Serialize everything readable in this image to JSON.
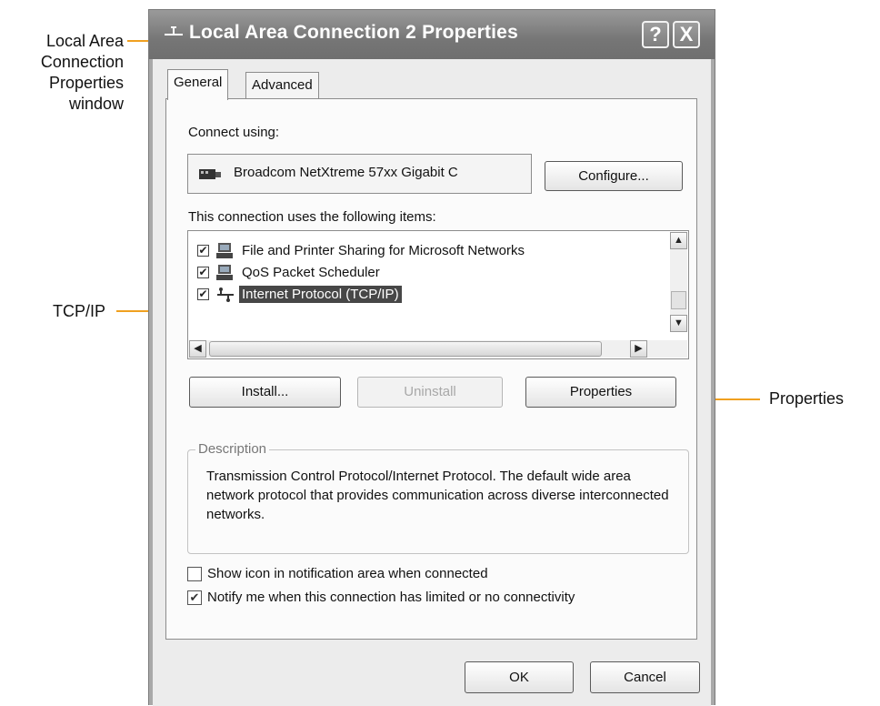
{
  "callouts": {
    "window_label": [
      "Local Area",
      "Connection",
      "Properties",
      "window"
    ],
    "tcpip_label": "TCP/IP",
    "properties_label": "Properties"
  },
  "window": {
    "title": "Local Area Connection 2 Properties",
    "help_glyph": "?",
    "close_glyph": "X"
  },
  "tabs": [
    {
      "label": "General",
      "active": true
    },
    {
      "label": "Advanced",
      "active": false
    }
  ],
  "general": {
    "connect_using_label": "Connect using:",
    "adapter_name": "Broadcom NetXtreme 57xx Gigabit C",
    "configure_label": "Configure...",
    "items_label": "This connection uses the following items:",
    "items": [
      {
        "label": "File and Printer Sharing for Microsoft Networks",
        "checked": true,
        "selected": false,
        "icon": "network-service-icon"
      },
      {
        "label": "QoS Packet Scheduler",
        "checked": true,
        "selected": false,
        "icon": "network-service-icon"
      },
      {
        "label": "Internet Protocol (TCP/IP)",
        "checked": true,
        "selected": true,
        "icon": "protocol-icon"
      }
    ],
    "install_label": "Install...",
    "uninstall_label": "Uninstall",
    "properties_label": "Properties",
    "description_legend": "Description",
    "description_text": "Transmission Control Protocol/Internet Protocol. The default wide area network protocol that provides communication across diverse interconnected networks.",
    "show_icon_label": "Show icon in notification area when connected",
    "show_icon_checked": false,
    "notify_label": "Notify me when this connection has limited or no connectivity",
    "notify_checked": true
  },
  "footer": {
    "ok_label": "OK",
    "cancel_label": "Cancel"
  },
  "colors": {
    "callout_line": "#f0a020",
    "selection": "#474747"
  }
}
